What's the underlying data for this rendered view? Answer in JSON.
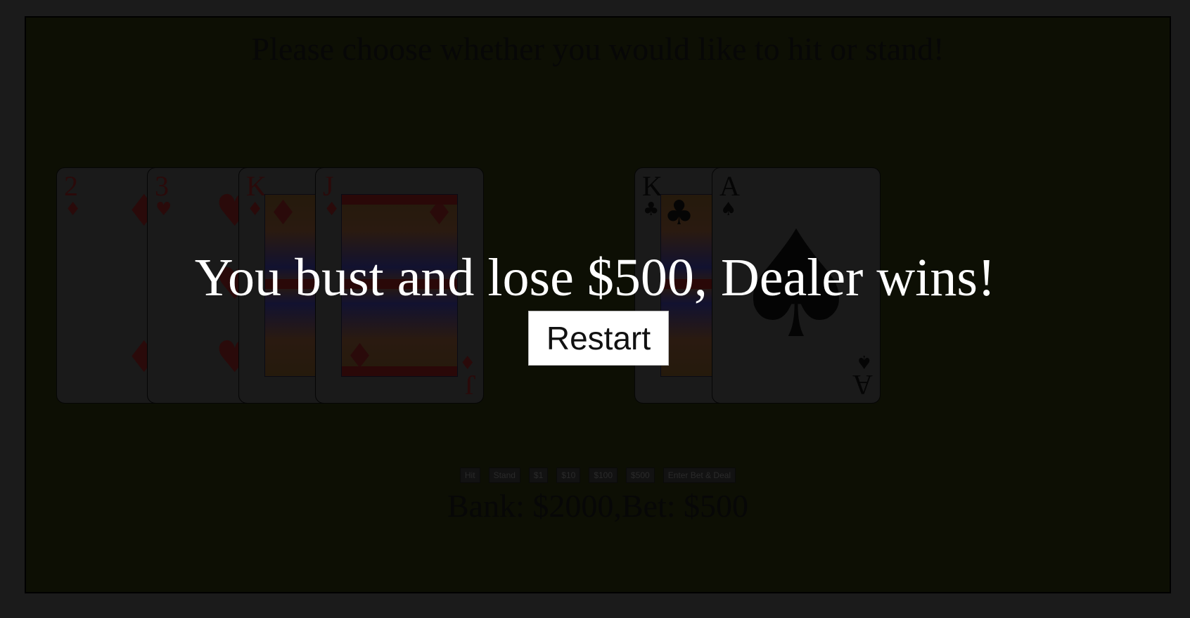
{
  "prompt": "Please choose whether you would like to hit or stand!",
  "player_hand": [
    {
      "rank": "2",
      "suit": "♦",
      "color": "red",
      "pips": [
        "♦",
        "♦"
      ]
    },
    {
      "rank": "3",
      "suit": "♥",
      "color": "red",
      "pips": [
        "♥",
        "♥",
        "♥"
      ]
    },
    {
      "rank": "K",
      "suit": "♦",
      "color": "red",
      "pips": [
        "♦",
        "♦"
      ]
    },
    {
      "rank": "J",
      "suit": "♦",
      "color": "red",
      "pips": [
        "♦",
        "♦"
      ]
    }
  ],
  "dealer_hand": [
    {
      "rank": "K",
      "suit": "♣",
      "color": "black",
      "pips": [
        "♣"
      ]
    },
    {
      "rank": "A",
      "suit": "♠",
      "color": "black",
      "pips": [
        "♠"
      ]
    }
  ],
  "controls": {
    "hit": "Hit",
    "stand": "Stand",
    "bet_1": "$1",
    "bet_10": "$10",
    "bet_100": "$100",
    "bet_500": "$500",
    "deal": "Enter Bet & Deal"
  },
  "bank_line": "Bank: $2000,Bet: $500",
  "result": {
    "message": "You bust and lose $500, Dealer wins!",
    "restart_label": "Restart"
  },
  "colors": {
    "page_bg": "#1b1b1b",
    "table_bg": "#0d0f04",
    "overlay_text": "#ffffff",
    "restart_bg": "#ffffff"
  },
  "icons": {
    "diamond": "diamond-suit-icon",
    "heart": "heart-suit-icon",
    "club": "club-suit-icon",
    "spade": "spade-suit-icon"
  }
}
